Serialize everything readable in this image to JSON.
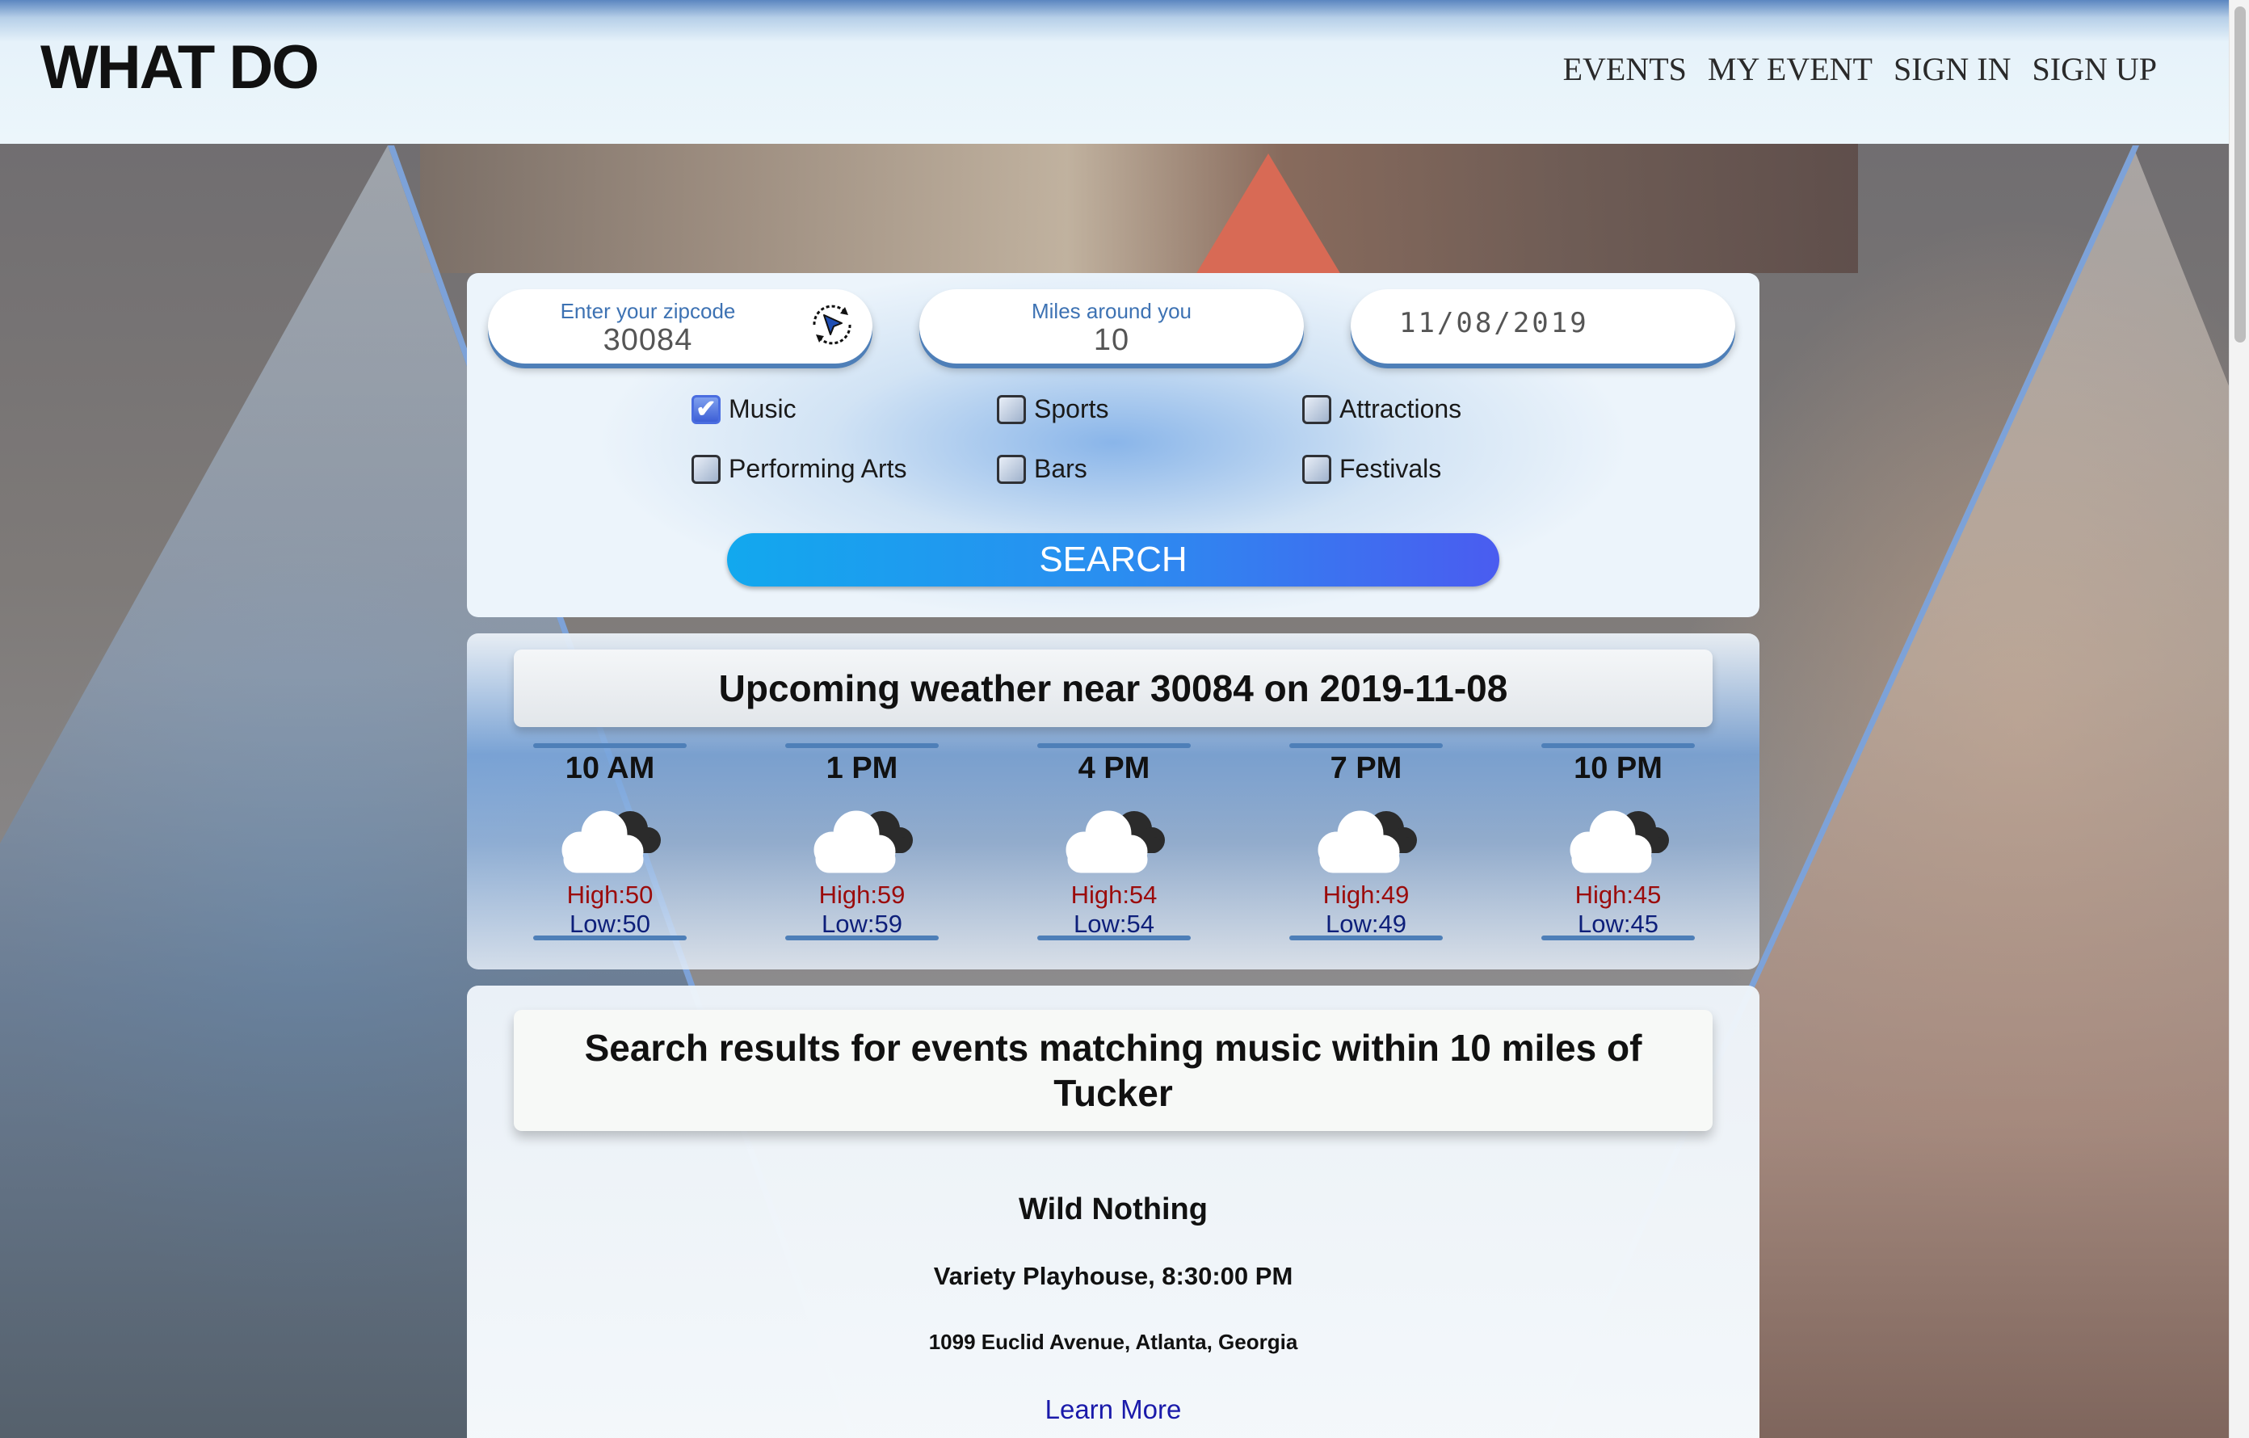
{
  "app": {
    "logo": "WHAT DO"
  },
  "nav": [
    "EVENTS",
    "MY EVENT",
    "SIGN IN",
    "SIGN UP"
  ],
  "search": {
    "zip_label": "Enter your zipcode",
    "zip_value": "30084",
    "miles_label": "Miles around you",
    "miles_value": "10",
    "date_value": "11/08/2019",
    "categories": [
      {
        "label": "Music",
        "checked": true
      },
      {
        "label": "Sports",
        "checked": false
      },
      {
        "label": "Attractions",
        "checked": false
      },
      {
        "label": "Performing Arts",
        "checked": false
      },
      {
        "label": "Bars",
        "checked": false
      },
      {
        "label": "Festivals",
        "checked": false
      }
    ],
    "button_label": "SEARCH"
  },
  "weather": {
    "title": "Upcoming weather near 30084 on 2019-11-08",
    "icon": "partly-cloudy-icon",
    "forecasts": [
      {
        "time": "10 AM",
        "high": "High:50",
        "low": "Low:50"
      },
      {
        "time": "1 PM",
        "high": "High:59",
        "low": "Low:59"
      },
      {
        "time": "4 PM",
        "high": "High:54",
        "low": "Low:54"
      },
      {
        "time": "7 PM",
        "high": "High:49",
        "low": "Low:49"
      },
      {
        "time": "10 PM",
        "high": "High:45",
        "low": "Low:45"
      }
    ]
  },
  "results": {
    "title": "Search results for events matching music within 10 miles of Tucker",
    "events": [
      {
        "name": "Wild Nothing",
        "venue_time": "Variety Playhouse, 8:30:00 PM",
        "address": "1099 Euclid Avenue, Atlanta, Georgia",
        "link_label": "Learn More"
      }
    ]
  },
  "colors": {
    "accent_blue": "#4e7fb8",
    "high_temp": "#9b0b0b",
    "low_temp": "#0d1f7a",
    "search_gradient_start": "#12a8ee",
    "search_gradient_end": "#4a5cf0",
    "link": "#1a1aaa"
  }
}
